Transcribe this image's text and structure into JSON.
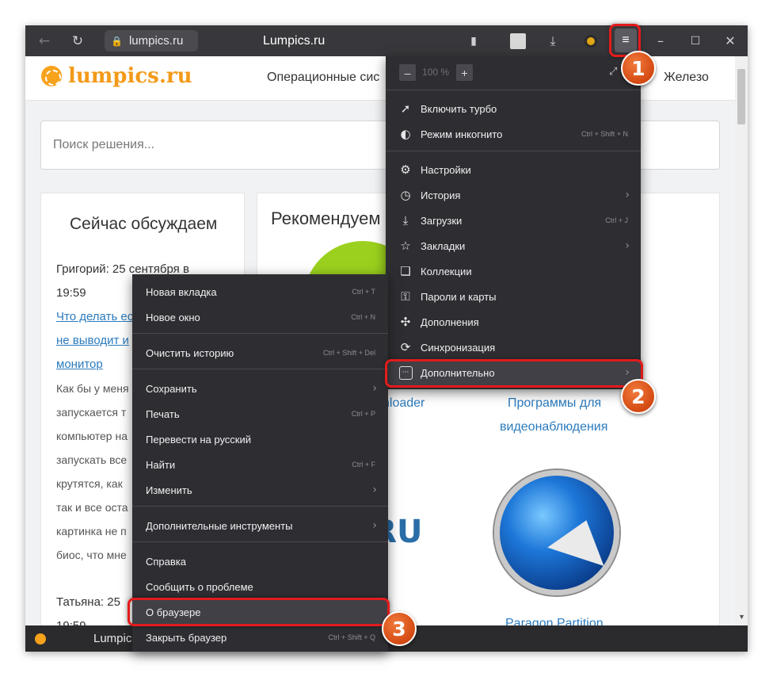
{
  "browser": {
    "address": "lumpics.ru",
    "title": "Lumpics.ru",
    "icons": [
      "back-icon",
      "reload-icon",
      "lock-icon",
      "bookmark-icon",
      "profile-icon",
      "download-icon",
      "protect-icon",
      "menu-icon",
      "minimize-icon",
      "maximize-icon",
      "close-icon"
    ]
  },
  "site": {
    "logo": "lumpics.ru",
    "nav_left": "Операционные сис",
    "nav_right": "Железо",
    "search_placeholder": "Поиск решения...",
    "discuss": {
      "title": "Сейчас обсуждаем",
      "author1": "Григорий: 25 сентября в",
      "time1": "19:59",
      "link1": "Что делать ес",
      "link2": "не выводит и",
      "link3": "монитор",
      "lines": [
        "Как бы у меня",
        "запускается т",
        "компьютер на",
        "запускать все",
        "крутятся, как",
        "так и все оста",
        "картинка не п",
        "биос, что мне"
      ],
      "author2": "Татьяна: 25",
      "time2": "19:59"
    },
    "recommend": {
      "title": "Рекомендуем",
      "link_loader": "nloader",
      "link_video_1": "Программы для",
      "link_video_2": "видеонаблюдения",
      "logo_ru": ".RU",
      "link_paragon": "Paragon Partition"
    }
  },
  "statusbar": {
    "tab": "Lumpics"
  },
  "main_menu": {
    "zoom": {
      "minus": "–",
      "value": "100 %",
      "plus": "+"
    },
    "items": [
      {
        "label": "Включить турбо",
        "icon": "rocket-icon",
        "shortcut": ""
      },
      {
        "label": "Режим инкогнито",
        "icon": "mask-icon",
        "shortcut": "Ctrl + Shift + N"
      },
      {
        "label": "Настройки",
        "icon": "gear-icon",
        "shortcut": ""
      },
      {
        "label": "История",
        "icon": "clock-icon",
        "shortcut": ""
      },
      {
        "label": "Загрузки",
        "icon": "download-icon",
        "shortcut": "Ctrl + J"
      },
      {
        "label": "Закладки",
        "icon": "star-icon",
        "shortcut": ""
      },
      {
        "label": "Коллекции",
        "icon": "collections-icon",
        "shortcut": ""
      },
      {
        "label": "Пароли и карты",
        "icon": "key-icon",
        "shortcut": ""
      },
      {
        "label": "Дополнения",
        "icon": "puzzle-icon",
        "shortcut": ""
      },
      {
        "label": "Синхронизация",
        "icon": "sync-icon",
        "shortcut": ""
      },
      {
        "label": "Дополнительно",
        "icon": "more-icon",
        "shortcut": ""
      }
    ]
  },
  "sub_menu": {
    "items": [
      {
        "label": "Новая вкладка",
        "shortcut": "Ctrl + T"
      },
      {
        "label": "Новое окно",
        "shortcut": "Ctrl + N"
      },
      {
        "label": "Очистить историю",
        "shortcut": "Ctrl + Shift + Del"
      },
      {
        "label": "Сохранить",
        "shortcut": ""
      },
      {
        "label": "Печать",
        "shortcut": "Ctrl + P"
      },
      {
        "label": "Перевести на русский",
        "shortcut": ""
      },
      {
        "label": "Найти",
        "shortcut": "Ctrl + F"
      },
      {
        "label": "Изменить",
        "shortcut": ""
      },
      {
        "label": "Дополнительные инструменты",
        "shortcut": ""
      },
      {
        "label": "Справка",
        "shortcut": ""
      },
      {
        "label": "Сообщить о проблеме",
        "shortcut": ""
      },
      {
        "label": "О браузере",
        "shortcut": ""
      },
      {
        "label": "Закрыть браузер",
        "shortcut": "Ctrl + Shift + Q"
      }
    ]
  },
  "annotations": {
    "step1": "1",
    "step2": "2",
    "step3": "3",
    "highlight_color": "#e31b1b",
    "badge_color": "#d44a12"
  }
}
